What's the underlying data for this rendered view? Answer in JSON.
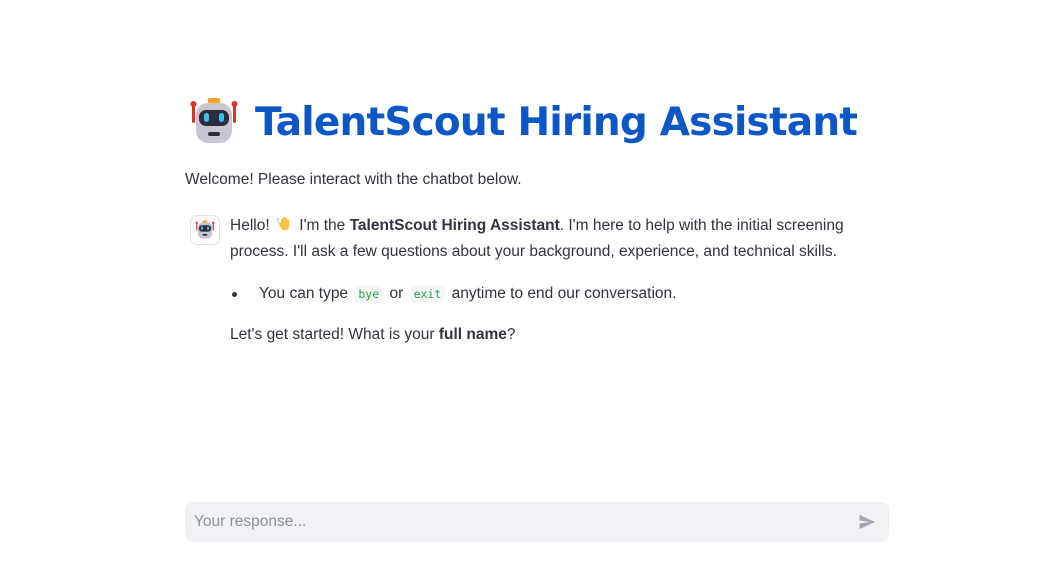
{
  "header": {
    "title": "TalentScout Hiring Assistant",
    "title_icon": "robot-icon",
    "title_color": "#0b57c6"
  },
  "welcome_text": "Welcome! Please interact with the chatbot below.",
  "chat": {
    "assistant_avatar": "robot-icon",
    "message": {
      "greeting": "Hello!",
      "wave_icon": "waving-hand-icon",
      "intro_prefix": "I'm the",
      "assistant_name": "TalentScout Hiring Assistant",
      "intro_suffix": ". I'm here to help with the initial screening process. I'll ask a few questions about your background, experience, and technical skills.",
      "tip_prefix": "You can type",
      "code_bye": "bye",
      "tip_or": "or",
      "code_exit": "exit",
      "tip_suffix": "anytime to end our conversation.",
      "question_prefix": "Let's get started! What is your",
      "question_bold": "full name",
      "question_suffix": "?"
    }
  },
  "input": {
    "placeholder": "Your response...",
    "value": "",
    "send_icon": "send-icon"
  },
  "colors": {
    "accent": "#0b57c6",
    "input_bg": "#f0f2f6",
    "code_text": "#21a347"
  }
}
